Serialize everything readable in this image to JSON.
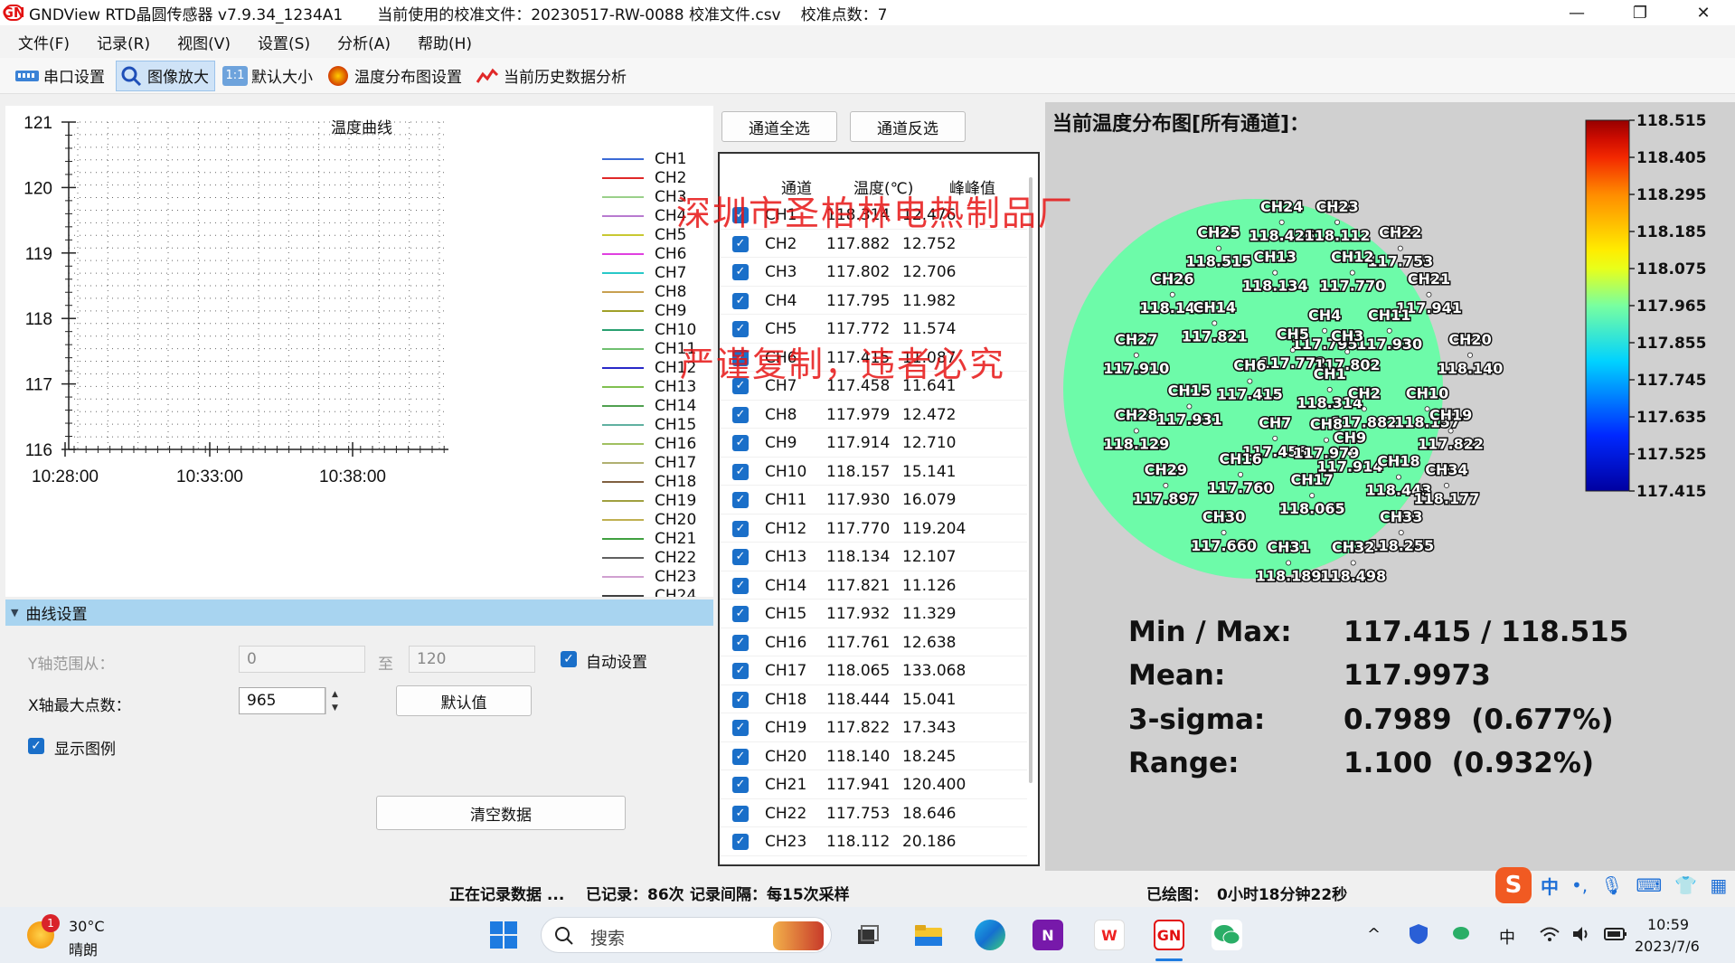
{
  "titlebar": {
    "logo": "GN",
    "app_title": "GNDView RTD晶圆传感器 v7.9.34_1234A1",
    "calib_file": "当前使用的校准文件：20230517-RW-0088 校准文件.csv",
    "calib_points": "校准点数：7",
    "minimize": "—",
    "restore": "❐",
    "close": "✕"
  },
  "menu": [
    "文件(F)",
    "记录(R)",
    "视图(V)",
    "设置(S)",
    "分析(A)",
    "帮助(H)"
  ],
  "toolbar": {
    "serial": "串口设置",
    "zoom": "图像放大",
    "zoom_badge": "1:1",
    "default_size": "默认大小",
    "dist_settings": "温度分布图设置",
    "history": "当前历史数据分析"
  },
  "chart_data": {
    "type": "line",
    "title": "温度曲线",
    "ylim": [
      116,
      121
    ],
    "yticks": [
      "121",
      "120",
      "119",
      "118",
      "117",
      "116"
    ],
    "xticks": [
      "10:28:00",
      "10:33:00",
      "10:38:00"
    ],
    "grid": true,
    "legend_position": "right",
    "series": [
      {
        "name": "CH1",
        "color": "#3a6ad6"
      },
      {
        "name": "CH2",
        "color": "#e02828"
      },
      {
        "name": "CH3",
        "color": "#9ad08a"
      },
      {
        "name": "CH4",
        "color": "#b87ad0"
      },
      {
        "name": "CH5",
        "color": "#c8c832"
      },
      {
        "name": "CH6",
        "color": "#e040e0"
      },
      {
        "name": "CH7",
        "color": "#28c8c8"
      },
      {
        "name": "CH8",
        "color": "#c8a050"
      },
      {
        "name": "CH9",
        "color": "#a0a028"
      },
      {
        "name": "CH10",
        "color": "#28a070"
      },
      {
        "name": "CH11",
        "color": "#70c070"
      },
      {
        "name": "CH12",
        "color": "#2828c8"
      },
      {
        "name": "CH13",
        "color": "#80c050"
      },
      {
        "name": "CH14",
        "color": "#50a050"
      },
      {
        "name": "CH15",
        "color": "#60b0a0"
      },
      {
        "name": "CH16",
        "color": "#a0c060"
      },
      {
        "name": "CH17",
        "color": "#b0b070"
      },
      {
        "name": "CH18",
        "color": "#806040"
      },
      {
        "name": "CH19",
        "color": "#a0a040"
      },
      {
        "name": "CH20",
        "color": "#c0b050"
      },
      {
        "name": "CH21",
        "color": "#40a040"
      },
      {
        "name": "CH22",
        "color": "#606060"
      },
      {
        "name": "CH23",
        "color": "#d0a0d0"
      },
      {
        "name": "CH24",
        "color": "#404040"
      }
    ]
  },
  "curve_settings": {
    "header": "曲线设置",
    "y_range_label": "Y轴范围从：",
    "y_from": "0",
    "y_to_label": "至",
    "y_to": "120",
    "auto_label": "自动设置",
    "x_max_label": "X轴最大点数：",
    "x_max": "965",
    "default_btn": "默认值",
    "show_legend_label": "显示图例",
    "clear_btn": "清空数据",
    "check_mark": "✓"
  },
  "channels": {
    "select_all": "通道全选",
    "invert": "通道反选",
    "head_channel": "通道",
    "head_temp": "温度(℃)",
    "head_pp": "峰峰值",
    "rows": [
      {
        "ch": "CH1",
        "temp": "118.314",
        "pp": "12.476"
      },
      {
        "ch": "CH2",
        "temp": "117.882",
        "pp": "12.752"
      },
      {
        "ch": "CH3",
        "temp": "117.802",
        "pp": "12.706"
      },
      {
        "ch": "CH4",
        "temp": "117.795",
        "pp": "11.982"
      },
      {
        "ch": "CH5",
        "temp": "117.772",
        "pp": "11.574"
      },
      {
        "ch": "CH6",
        "temp": "117.415",
        "pp": "11.087"
      },
      {
        "ch": "CH7",
        "temp": "117.458",
        "pp": "11.641"
      },
      {
        "ch": "CH8",
        "temp": "117.979",
        "pp": "12.472"
      },
      {
        "ch": "CH9",
        "temp": "117.914",
        "pp": "12.710"
      },
      {
        "ch": "CH10",
        "temp": "118.157",
        "pp": "15.141"
      },
      {
        "ch": "CH11",
        "temp": "117.930",
        "pp": "16.079"
      },
      {
        "ch": "CH12",
        "temp": "117.770",
        "pp": "119.204"
      },
      {
        "ch": "CH13",
        "temp": "118.134",
        "pp": "12.107"
      },
      {
        "ch": "CH14",
        "temp": "117.821",
        "pp": "11.126"
      },
      {
        "ch": "CH15",
        "temp": "117.932",
        "pp": "11.329"
      },
      {
        "ch": "CH16",
        "temp": "117.761",
        "pp": "12.638"
      },
      {
        "ch": "CH17",
        "temp": "118.065",
        "pp": "133.068"
      },
      {
        "ch": "CH18",
        "temp": "118.444",
        "pp": "15.041"
      },
      {
        "ch": "CH19",
        "temp": "117.822",
        "pp": "17.343"
      },
      {
        "ch": "CH20",
        "temp": "118.140",
        "pp": "18.245"
      },
      {
        "ch": "CH21",
        "temp": "117.941",
        "pp": "120.400"
      },
      {
        "ch": "CH22",
        "temp": "117.753",
        "pp": "18.646"
      },
      {
        "ch": "CH23",
        "temp": "118.112",
        "pp": "20.186"
      }
    ]
  },
  "distribution": {
    "title": "当前温度分布图[所有通道]：",
    "colorbar_ticks": [
      "118.515",
      "118.405",
      "118.295",
      "118.185",
      "118.075",
      "117.965",
      "117.855",
      "117.745",
      "117.635",
      "117.525",
      "117.415"
    ],
    "points": [
      {
        "name": "CH24",
        "value": "118.426",
        "temp": 118.426
      },
      {
        "name": "CH23",
        "value": "118.112",
        "temp": 118.112
      },
      {
        "name": "CH25",
        "value": "118.515",
        "temp": 118.515
      },
      {
        "name": "CH22",
        "value": "117.753",
        "temp": 117.753
      },
      {
        "name": "CH13",
        "value": "118.134",
        "temp": 118.134
      },
      {
        "name": "CH12",
        "value": "117.770",
        "temp": 117.77
      },
      {
        "name": "CH26",
        "value": "118.143",
        "temp": 118.143
      },
      {
        "name": "CH21",
        "value": "117.941",
        "temp": 117.941
      },
      {
        "name": "CH14",
        "value": "117.821",
        "temp": 117.821
      },
      {
        "name": "CH4",
        "value": "117.795",
        "temp": 117.795
      },
      {
        "name": "CH11",
        "value": "117.930",
        "temp": 117.93
      },
      {
        "name": "CH5",
        "value": "117.772",
        "temp": 117.772
      },
      {
        "name": "CH3",
        "value": "117.802",
        "temp": 117.802
      },
      {
        "name": "CH27",
        "value": "117.910",
        "temp": 117.91
      },
      {
        "name": "CH20",
        "value": "118.140",
        "temp": 118.14
      },
      {
        "name": "CH6",
        "value": "117.415",
        "temp": 117.415
      },
      {
        "name": "CH1",
        "value": "118.314",
        "temp": 118.314
      },
      {
        "name": "CH15",
        "value": "117.931",
        "temp": 117.931
      },
      {
        "name": "CH2",
        "value": "117.882",
        "temp": 117.882
      },
      {
        "name": "CH10",
        "value": "118.157",
        "temp": 118.157
      },
      {
        "name": "CH28",
        "value": "118.129",
        "temp": 118.129
      },
      {
        "name": "CH7",
        "value": "117.458",
        "temp": 117.458
      },
      {
        "name": "CH8",
        "value": "117.979",
        "temp": 117.979
      },
      {
        "name": "CH9",
        "value": "117.914",
        "temp": 117.914
      },
      {
        "name": "CH19",
        "value": "117.822",
        "temp": 117.822
      },
      {
        "name": "CH16",
        "value": "117.760",
        "temp": 117.76
      },
      {
        "name": "CH18",
        "value": "118.443",
        "temp": 118.443
      },
      {
        "name": "CH29",
        "value": "117.897",
        "temp": 117.897
      },
      {
        "name": "CH34",
        "value": "118.177",
        "temp": 118.177
      },
      {
        "name": "CH17",
        "value": "118.065",
        "temp": 118.065
      },
      {
        "name": "CH30",
        "value": "117.660",
        "temp": 117.66
      },
      {
        "name": "CH33",
        "value": "118.255",
        "temp": 118.255
      },
      {
        "name": "CH31",
        "value": "118.189",
        "temp": 118.189
      },
      {
        "name": "CH32",
        "value": "118.498",
        "temp": 118.498
      }
    ],
    "stats": {
      "minmax_label": "Min / Max:",
      "minmax_value": "117.415 / 118.515",
      "mean_label": "Mean:",
      "mean_value": "117.9973",
      "sigma_label": "3-sigma:",
      "sigma_value": "0.7989  (0.677%)",
      "range_label": "Range:",
      "range_value": "1.100  (0.932%)"
    }
  },
  "watermarks": {
    "line1": "深圳市圣柏林电热制品厂",
    "line2": "严谨复制，违者必究"
  },
  "status": {
    "recording": "正在记录数据 ...",
    "recorded": "已记录：86次",
    "interval": "记录间隔：每15次采样",
    "drawn": "已绘图：",
    "drawn_time": "0小时18分钟22秒"
  },
  "taskbar": {
    "weather_temp": "30°C",
    "weather_text": "晴朗",
    "weather_badge": "1",
    "search_placeholder": "搜索",
    "ime_cn": "中",
    "ime_tray": "中",
    "time": "10:59",
    "date": "2023/7/6",
    "app_onenote": "N",
    "app_wps": "W",
    "app_gnd": "GN",
    "app_sogou": "S",
    "caret_up": "^"
  }
}
